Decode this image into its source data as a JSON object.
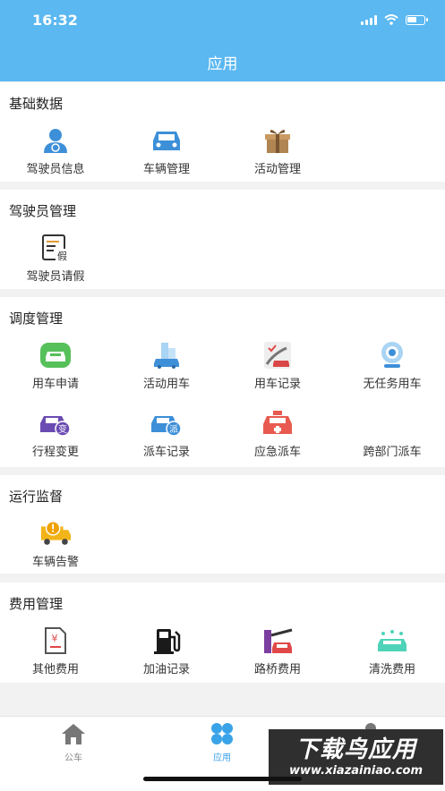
{
  "status_bar": {
    "time": "16:32"
  },
  "header": {
    "title": "应用"
  },
  "sections": [
    {
      "title": "基础数据",
      "items": [
        {
          "label": "驾驶员信息",
          "icon": "driver-icon"
        },
        {
          "label": "车辆管理",
          "icon": "car-icon"
        },
        {
          "label": "活动管理",
          "icon": "gift-box-icon"
        }
      ]
    },
    {
      "title": "驾驶员管理",
      "items": [
        {
          "label": "驾驶员请假",
          "icon": "leave-form-icon",
          "badge": "假"
        }
      ]
    },
    {
      "title": "调度管理",
      "items": [
        {
          "label": "用车申请",
          "icon": "car-request-icon"
        },
        {
          "label": "活动用车",
          "icon": "activity-car-icon"
        },
        {
          "label": "用车记录",
          "icon": "car-record-icon"
        },
        {
          "label": "无任务用车",
          "icon": "camera-icon"
        },
        {
          "label": "行程变更",
          "icon": "trip-change-icon",
          "badge": "变"
        },
        {
          "label": "派车记录",
          "icon": "dispatch-record-icon",
          "badge": "派"
        },
        {
          "label": "应急派车",
          "icon": "emergency-car-icon"
        },
        {
          "label": "跨部门派车",
          "icon": "cross-department-icon"
        }
      ]
    },
    {
      "title": "运行监督",
      "items": [
        {
          "label": "车辆告警",
          "icon": "alarm-truck-icon"
        }
      ]
    },
    {
      "title": "费用管理",
      "items": [
        {
          "label": "其他费用",
          "icon": "other-fee-icon",
          "badge": "¥"
        },
        {
          "label": "加油记录",
          "icon": "fuel-icon"
        },
        {
          "label": "路桥费用",
          "icon": "toll-icon"
        },
        {
          "label": "清洗费用",
          "icon": "car-wash-icon"
        }
      ]
    }
  ],
  "tabbar": [
    {
      "label": "公车",
      "icon": "home-icon"
    },
    {
      "label": "应用",
      "icon": "apps-grid-icon",
      "active": true
    },
    {
      "label": "",
      "icon": "profile-icon"
    }
  ],
  "watermark": {
    "line1": "下载鸟应用",
    "line2": "www.xiazainiao.com"
  },
  "colors": {
    "header": "#5bb8f1",
    "active_tab": "#3aa3e8",
    "inactive_tab": "#888888"
  }
}
